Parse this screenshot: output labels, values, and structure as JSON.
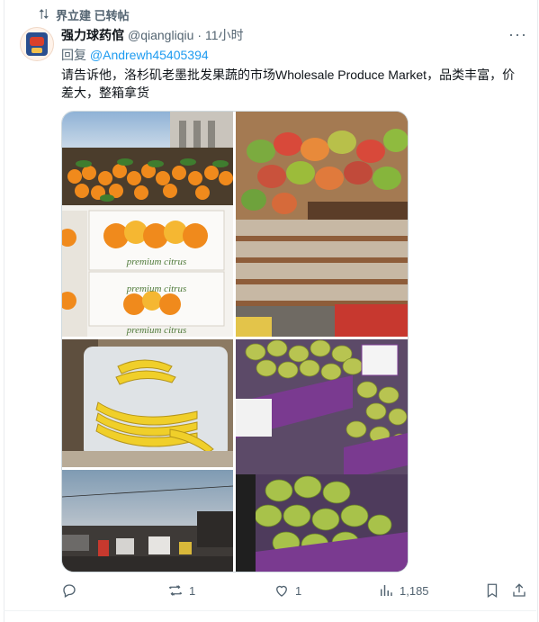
{
  "retweet": {
    "label": "界立建 已转帖"
  },
  "tweet": {
    "author_name": "强力球药倌",
    "handle": "@qiangliqiu",
    "separator": "·",
    "time": "11小时",
    "reply_prefix": "回复",
    "reply_to": "@Andrewh45405394",
    "text": "请告诉他，洛杉矶老墨批发果蔬的市场Wholesale Produce Market，品类丰富，价差大，整箱拿货",
    "more": "···"
  },
  "images": {
    "crate_label_1": "premium citrus",
    "crate_label_2": "premium citrus",
    "crate_label_3": "premium citrus"
  },
  "actions": {
    "replies": "",
    "retweets": "1",
    "likes": "1",
    "views": "1,185"
  },
  "colors": {
    "link": "#1d9bf0",
    "secondary": "#536471",
    "primary": "#0f1419"
  }
}
